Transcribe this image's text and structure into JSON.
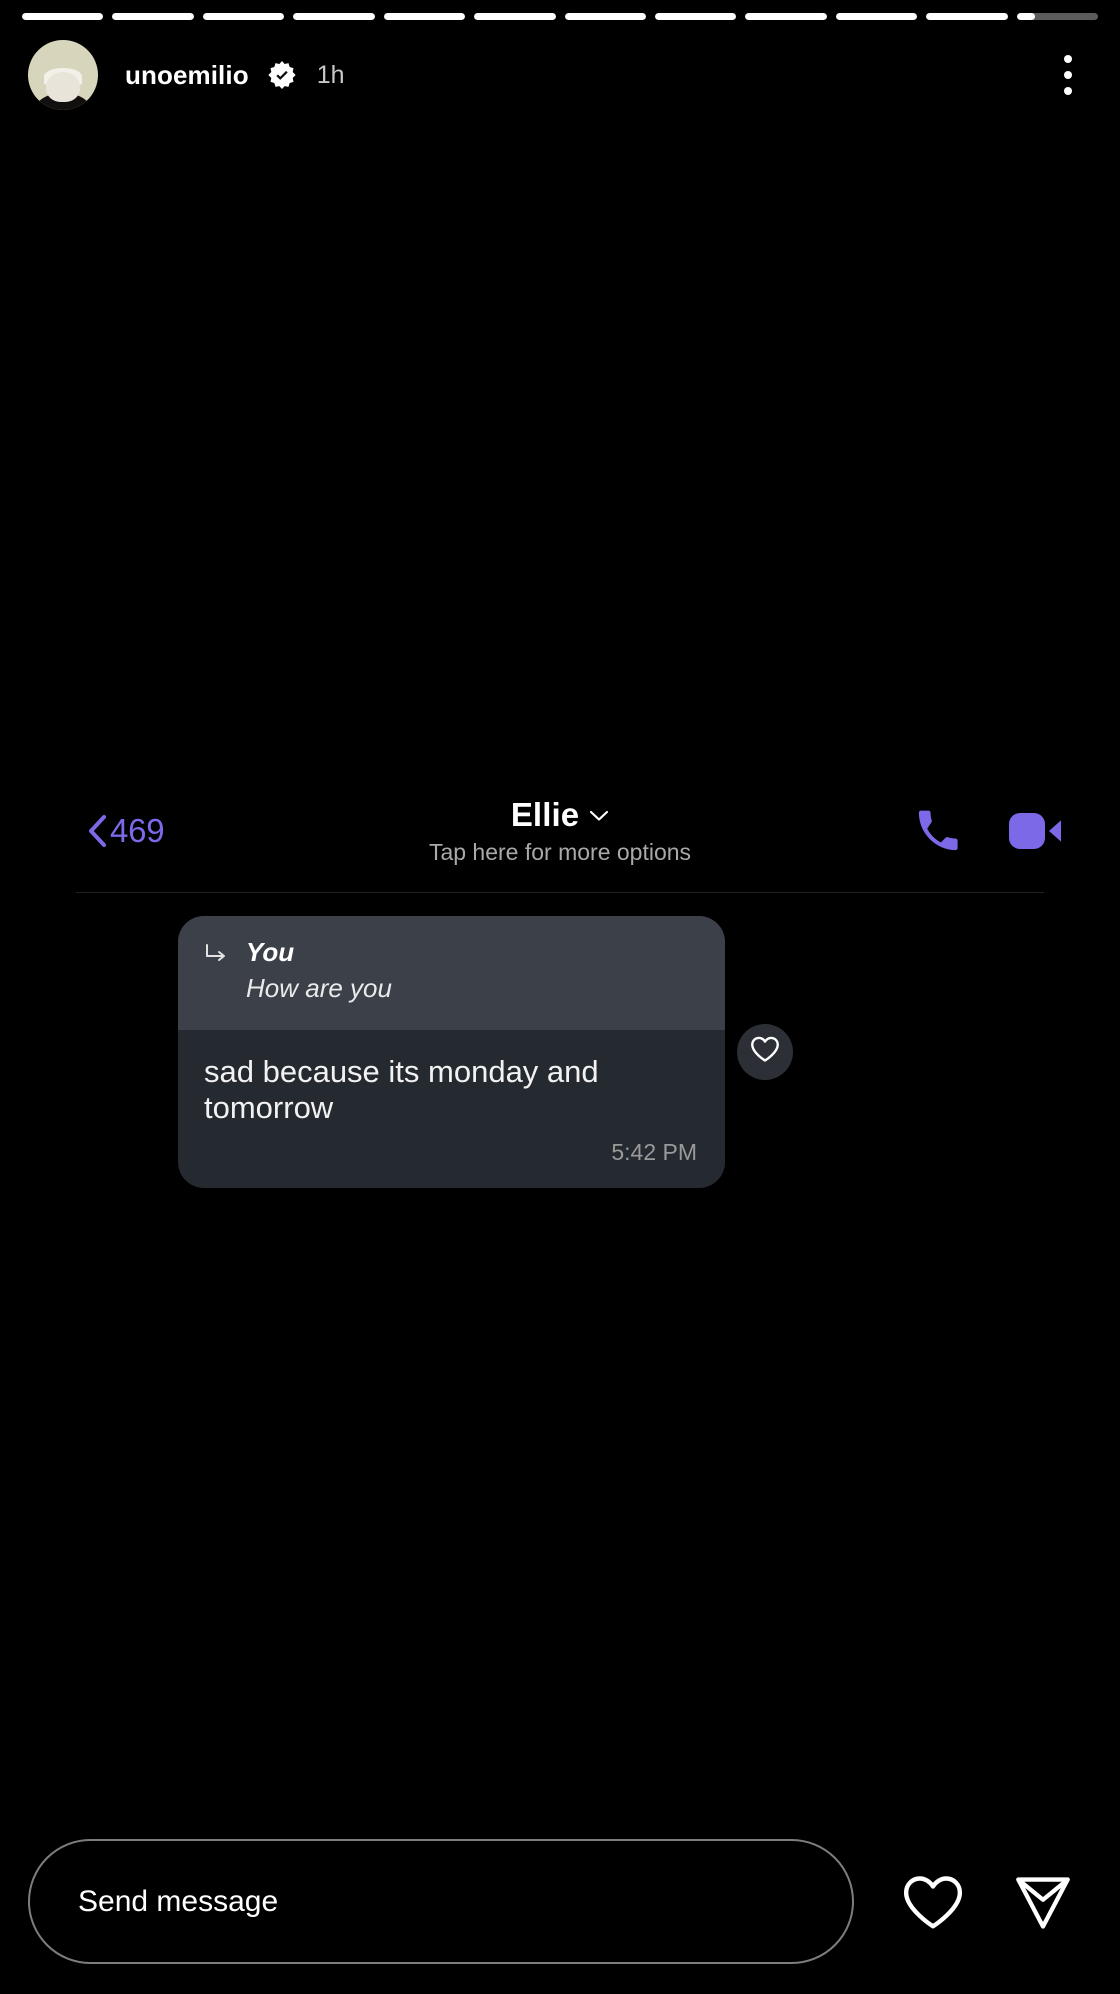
{
  "story": {
    "progress": {
      "total_segments": 12,
      "active_index": 11,
      "active_fill_percent": 22
    },
    "username": "unoemilio",
    "verified": true,
    "verified_icon": "verified-badge-icon",
    "timestamp": "1h",
    "menu_icon": "more-options-kebab-icon",
    "avatar_alt": "unoemilio-avatar"
  },
  "chat": {
    "back": {
      "icon": "chevron-left-icon",
      "count": "469"
    },
    "title": "Ellie",
    "title_chevron_icon": "chevron-down-icon",
    "subtitle": "Tap here for more options",
    "actions": [
      {
        "name": "audio-call-button",
        "icon": "phone-icon",
        "color": "#7B69E8"
      },
      {
        "name": "video-call-button",
        "icon": "video-camera-icon",
        "color": "#7B69E8"
      }
    ],
    "message": {
      "quote": {
        "arrow_icon": "reply-arrow-icon",
        "author": "You",
        "text": "How are you"
      },
      "text": "sad because its monday and tomorrow",
      "time": "5:42 PM",
      "reaction_icon": "heart-outline-icon"
    }
  },
  "composer": {
    "placeholder": "Send message",
    "value": "",
    "like_icon": "heart-outline-icon",
    "send_icon": "send-paper-plane-icon"
  },
  "colors": {
    "background": "#000000",
    "accent_purple": "#7B69E8",
    "bubble": "#252930",
    "quote_bubble": "#3B4049",
    "muted_text": "#a9a9a9"
  }
}
